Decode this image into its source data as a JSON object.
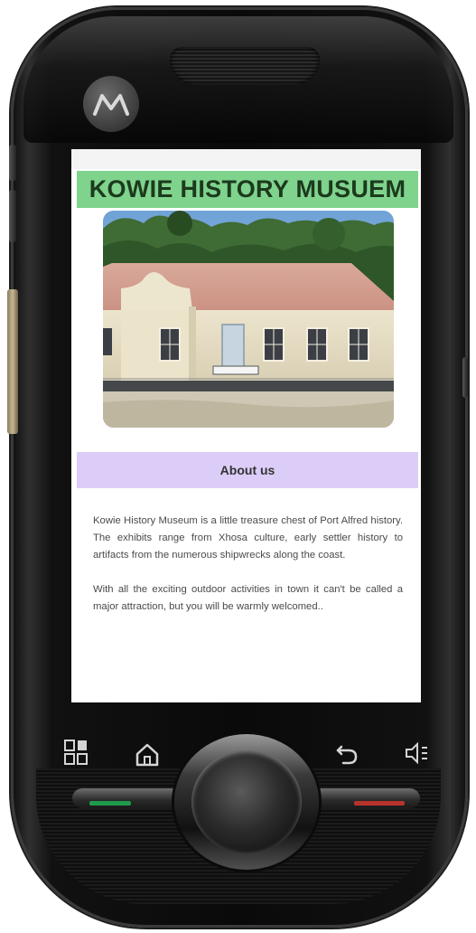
{
  "device": {
    "brand_logo": "motorola-logo-icon"
  },
  "app": {
    "title": "KOWIE HISTORY MUSUEM",
    "photo": {
      "sign_text": "",
      "icon": "museum-photo"
    },
    "about": {
      "heading": "About us",
      "paragraphs": [
        "Kowie History Museum is a little treasure chest of Port Alfred history. The exhibits range from Xhosa culture, early settler history to artifacts from the numerous shipwrecks along the coast.",
        "With all the exciting outdoor activities in town it can't be called a major attraction, but you will be warmly welcomed.."
      ]
    }
  },
  "colors": {
    "title_bar": "#7fd38d",
    "about_bar": "#dccdf8",
    "call_button": "#1f9a4d",
    "end_button": "#b8332c"
  },
  "nav_keys": {
    "menu": "menu-grid-icon",
    "home": "home-icon",
    "back": "back-arrow-icon",
    "volume": "volume-icon"
  }
}
